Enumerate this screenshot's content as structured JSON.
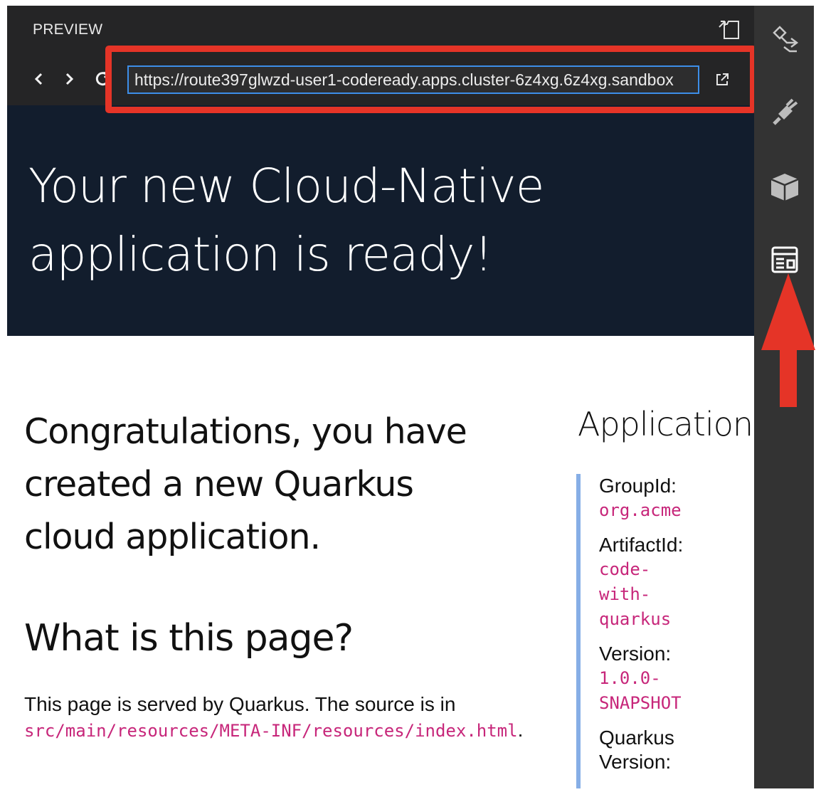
{
  "preview": {
    "title": "PREVIEW",
    "url": "https://route397glwzd-user1-codeready.apps.cluster-6z4xg.6z4xg.sandbox",
    "nav": {
      "back": "chevron-left",
      "forward": "chevron-right",
      "reload": "refresh"
    }
  },
  "page": {
    "hero_title_line1": "Your new Cloud-Native",
    "hero_title_line2": "application is ready!",
    "congrats_line1": "Congratulations, you have",
    "congrats_line2": "created a new Quarkus",
    "congrats_line3": "cloud application.",
    "section_title": "What is this page?",
    "source_text": "This page is served by Quarkus. The source is in ",
    "source_path": "src/main/resources/META-INF/resources/index.html",
    "source_period": ".",
    "app_heading": "Application",
    "info": [
      {
        "label": "GroupId:",
        "value": "org.acme"
      },
      {
        "label": "ArtifactId:",
        "value": "code-\nwith-\nquarkus"
      },
      {
        "label": "Version:",
        "value": "1.0.0-\nSNAPSHOT"
      },
      {
        "label": "Quarkus",
        "value": "Version:"
      }
    ]
  },
  "colors": {
    "annotation": "#e53427",
    "link_code": "#c7267a",
    "hero_bg": "#121d2d"
  },
  "activity_bar": [
    "workflow-icon",
    "plug-icon",
    "box-icon",
    "preview-icon"
  ]
}
